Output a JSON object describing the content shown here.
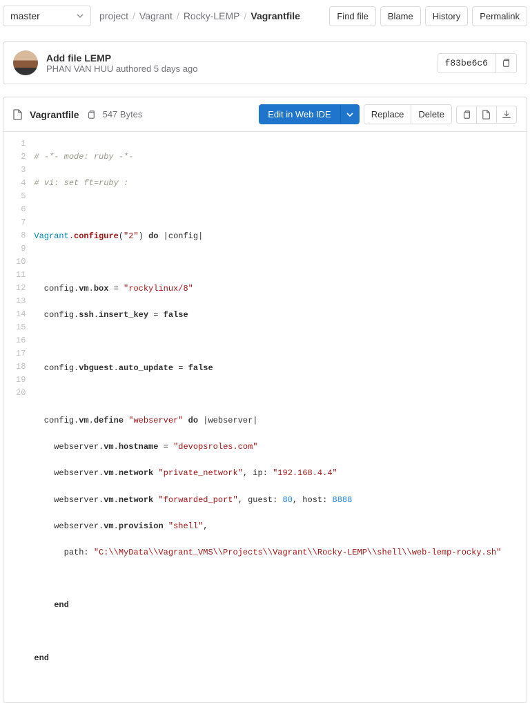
{
  "branch": "master",
  "breadcrumbs": {
    "p0": "project",
    "p1": "Vagrant",
    "p2": "Rocky-LEMP",
    "current": "Vagrantfile"
  },
  "topButtons": {
    "find": "Find file",
    "blame": "Blame",
    "history": "History",
    "permalink": "Permalink"
  },
  "commit": {
    "title": "Add file LEMP",
    "author": "PHAN VAN HUU",
    "verb": "authored",
    "when": "5 days ago",
    "sha": "f83be6c6"
  },
  "file": {
    "name": "Vagrantfile",
    "size": "547 Bytes"
  },
  "actions": {
    "edit": "Edit in Web IDE",
    "replace": "Replace",
    "delete": "Delete"
  },
  "code": {
    "lineCount": 20,
    "l1a": "# -*- mode: ruby -*-",
    "l2a": "# vi: set ft=ruby :",
    "l4_vagrant": "Vagrant",
    "l4_conf": "configure",
    "l4_arg": "\"2\"",
    "l4_do": "do",
    "l4_pipe": "|config|",
    "l6_a": "  config.",
    "l6_vm": "vm",
    "l6_b": ".",
    "l6_box": "box",
    "l6_eq": " = ",
    "l6_s": "\"rockylinux/8\"",
    "l7_a": "  config.",
    "l7_ssh": "ssh",
    "l7_b": ".",
    "l7_ik": "insert_key",
    "l7_eq": " = ",
    "l7_v": "false",
    "l9_a": "  config.",
    "l9_vb": "vbguest",
    "l9_b": ".",
    "l9_au": "auto_update",
    "l9_eq": " = ",
    "l9_v": "false",
    "l11_a": "  config.",
    "l11_vm": "vm",
    "l11_b": ".",
    "l11_def": "define",
    "l11_sp": " ",
    "l11_s": "\"webserver\"",
    "l11_do": " do ",
    "l11_p": "|webserver|",
    "l12_a": "    webserver.",
    "l12_vm": "vm",
    "l12_b": ".",
    "l12_hn": "hostname",
    "l12_eq": " = ",
    "l12_s": "\"devopsroles.com\"",
    "l13_a": "    webserver.",
    "l13_vm": "vm",
    "l13_b": ".",
    "l13_nw": "network",
    "l13_sp": " ",
    "l13_s": "\"private_network\"",
    "l13_ip": ", ip: ",
    "l13_ipv": "\"192.168.4.4\"",
    "l14_a": "    webserver.",
    "l14_vm": "vm",
    "l14_b": ".",
    "l14_nw": "network",
    "l14_sp": " ",
    "l14_s": "\"forwarded_port\"",
    "l14_g": ", guest: ",
    "l14_gv": "80",
    "l14_h": ", host: ",
    "l14_hv": "8888",
    "l15_a": "    webserver.",
    "l15_vm": "vm",
    "l15_b": ".",
    "l15_pr": "provision",
    "l15_sp": " ",
    "l15_s": "\"shell\"",
    "l15_c": ",",
    "l16_a": "      path: ",
    "l16_s": "\"C:\\\\MyData\\\\Vagrant_VMS\\\\Projects\\\\Vagrant\\\\Rocky-LEMP\\\\shell\\\\web-lemp-rocky.sh\"",
    "l18": "    end",
    "l20": "end"
  }
}
